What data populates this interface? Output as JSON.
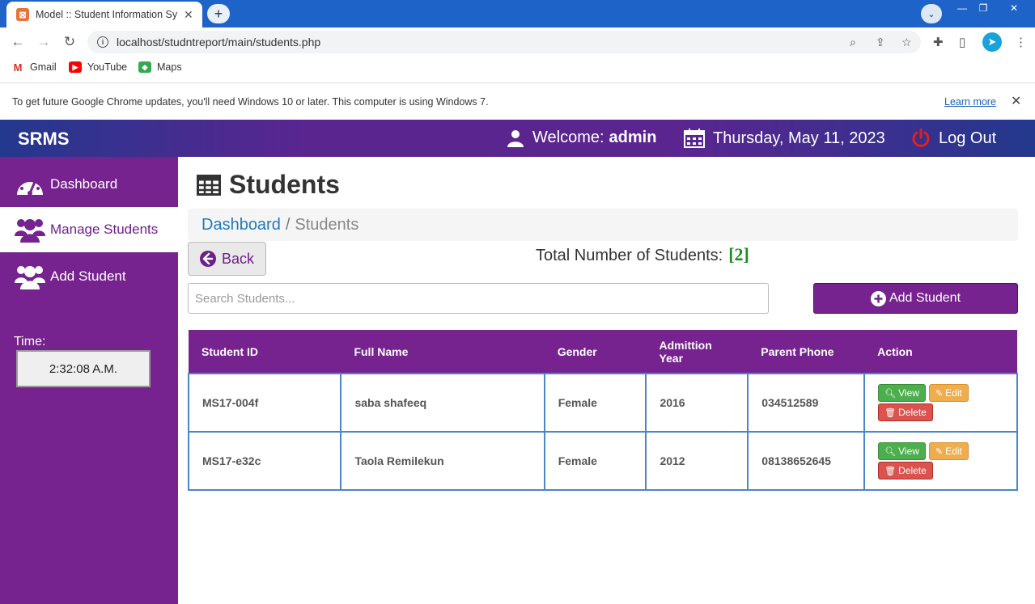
{
  "browser": {
    "tab_title": "Model :: Student Information System",
    "url": "localhost/studntreport/main/students.php",
    "bookmarks": [
      {
        "label": "Gmail",
        "color": "#d93025"
      },
      {
        "label": "YouTube",
        "color": "#ff0000"
      },
      {
        "label": "Maps",
        "color": "#34a853"
      }
    ],
    "infobar_text": "To get future Google Chrome updates, you'll need Windows 10 or later. This computer is using Windows 7.",
    "infobar_link": "Learn more"
  },
  "header": {
    "brand": "SRMS",
    "welcome_prefix": "Welcome:",
    "welcome_user": "admin",
    "date": "Thursday, May 11, 2023",
    "logout": "Log Out"
  },
  "sidebar": {
    "items": [
      {
        "label": "Dashboard",
        "icon": "dashboard-icon"
      },
      {
        "label": "Manage Students",
        "icon": "users-icon",
        "active": true
      },
      {
        "label": "Add Student",
        "icon": "users-icon"
      }
    ],
    "time_label": "Time:",
    "time_value": "2:32:08 A.M."
  },
  "main": {
    "title": "Students",
    "breadcrumb": {
      "link": "Dashboard",
      "separator": "/",
      "current": "Students"
    },
    "back_label": "Back",
    "total_label": "Total Number of Students:",
    "total_count": "[2]",
    "search_placeholder": "Search Students...",
    "add_label": "Add Student"
  },
  "table": {
    "headers": [
      "Student ID",
      "Full Name",
      "Gender",
      "Admittion Year",
      "Parent Phone",
      "Action"
    ],
    "rows": [
      {
        "id": "MS17-004f",
        "name": "saba shafeeq",
        "gender": "Female",
        "year": "2016",
        "phone": "034512589"
      },
      {
        "id": "MS17-e32c",
        "name": "Taola Remilekun",
        "gender": "Female",
        "year": "2012",
        "phone": "08138652645"
      }
    ],
    "actions": {
      "view": "View",
      "edit": "Edit",
      "delete": "Delete"
    }
  },
  "colors": {
    "sidebar": "#76228f",
    "header_start": "#23388e",
    "header_mid": "#5b2590",
    "link": "#1f7ac2",
    "count": "#1e8a28"
  }
}
